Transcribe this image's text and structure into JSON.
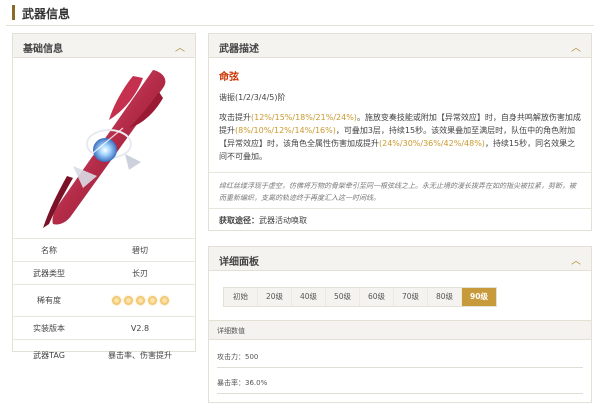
{
  "page": {
    "title": "武器信息"
  },
  "basic": {
    "title": "基础信息",
    "rows": [
      {
        "key": "名称",
        "value": "碧切"
      },
      {
        "key": "武器类型",
        "value": "长刃"
      },
      {
        "key": "稀有度",
        "stars": 5
      },
      {
        "key": "实装版本",
        "value": "V2.8"
      },
      {
        "key": "武器TAG",
        "value": "暴击率、伤害提升"
      }
    ]
  },
  "desc": {
    "title": "武器描述",
    "skill_name": "命弦",
    "refine": "谐振(1/2/3/4/5)阶",
    "effect_parts": [
      {
        "t": "攻击提升",
        "h": false
      },
      {
        "t": "(12%/15%/18%/21%/24%)",
        "h": true
      },
      {
        "t": "。施放变奏技能或附加【异常效应】时，自身共鸣解放伤害加成提升",
        "h": false
      },
      {
        "t": "(8%/10%/12%/14%/16%)",
        "h": true
      },
      {
        "t": "，可叠加3层，持续15秒。该效果叠加至满层时，队伍中的角色附加【异常效应】时，该角色全属性伤害加成提升",
        "h": false
      },
      {
        "t": "(24%/30%/36%/42%/48%)",
        "h": true
      },
      {
        "t": "，持续15秒，同名效果之间不可叠加。",
        "h": false
      }
    ],
    "flavor": "绯红丝缕浮现于虚空，仿佛将万物的骨架牵引至同一根弦线之上。永无止境的漫长拨弄在如的指尖被拉紧，剪断，被而重新编织，支离的轨迹终于再度汇入这一时间线。",
    "source_label": "获取途径：",
    "source_value": "武器活动唤取"
  },
  "detail": {
    "title": "详细面板",
    "levels": [
      "初始",
      "20级",
      "40级",
      "50级",
      "60级",
      "70级",
      "80级",
      "90级"
    ],
    "active_level": "90级",
    "stats_header": "详细数值",
    "stats": [
      {
        "label": "攻击力：",
        "value": "500"
      },
      {
        "label": "暴击率：",
        "value": "36.0%"
      }
    ]
  },
  "colors": {
    "accent": "#c79a3c",
    "skill": "#cc3300",
    "highlight": "#c99a2e"
  },
  "icons": {
    "collapse": "chevron-up-icon",
    "star": "star-icon"
  }
}
